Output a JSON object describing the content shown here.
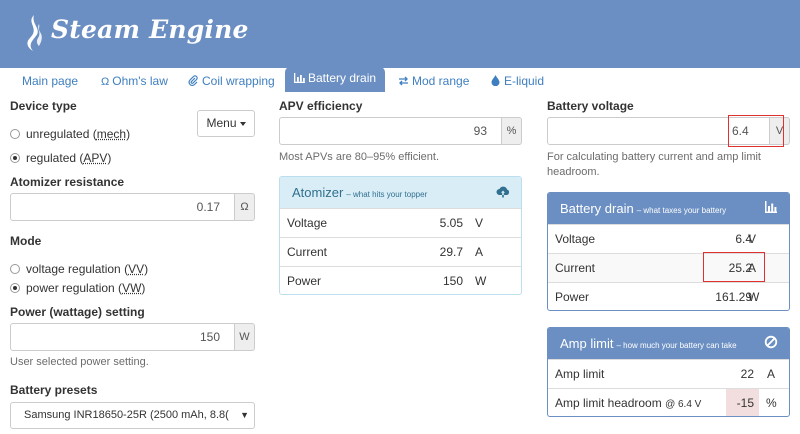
{
  "app": {
    "title": "Steam Engine"
  },
  "tabs": [
    {
      "label": "Main page",
      "icon": ""
    },
    {
      "label": "Ohm's law",
      "icon": "Ω"
    },
    {
      "label": "Coil wrapping",
      "icon": "paperclip-icon"
    },
    {
      "label": "Battery drain",
      "icon": "bar-chart-icon",
      "active": true
    },
    {
      "label": "Mod range",
      "icon": "swap-icon"
    },
    {
      "label": "E-liquid",
      "icon": "droplet-icon"
    }
  ],
  "left": {
    "device_type_label": "Device type",
    "menu_button": "Menu",
    "device_options": [
      {
        "pre": "unregulated (",
        "u": "mech",
        "post": ")",
        "checked": false
      },
      {
        "pre": "regulated (",
        "u": "APV",
        "post": ")",
        "checked": true
      }
    ],
    "atomizer_resistance_label": "Atomizer resistance",
    "atomizer_resistance_value": "0.17",
    "atomizer_resistance_unit": "Ω",
    "mode_label": "Mode",
    "mode_options": [
      {
        "pre": "voltage regulation (",
        "u": "VV",
        "post": ")",
        "checked": false
      },
      {
        "pre": "power regulation (",
        "u": "VW",
        "post": ")",
        "checked": true
      }
    ],
    "power_label": "Power (wattage) setting",
    "power_value": "150",
    "power_unit": "W",
    "power_help": "User selected power setting.",
    "presets_label": "Battery presets",
    "presets_selected": "Samsung INR18650-25R (2500 mAh, 8.8("
  },
  "middle": {
    "apv_label": "APV efficiency",
    "apv_value": "93",
    "apv_unit": "%",
    "apv_help": "Most APVs are 80–95% efficient.",
    "atomizer_panel": {
      "title": "Atomizer",
      "subtitle": "– what hits your topper",
      "rows": [
        {
          "label": "Voltage",
          "value": "5.05",
          "unit": "V"
        },
        {
          "label": "Current",
          "value": "29.7",
          "unit": "A"
        },
        {
          "label": "Power",
          "value": "150",
          "unit": "W"
        }
      ]
    }
  },
  "right": {
    "battery_voltage_label": "Battery voltage",
    "battery_voltage_value": "6.4",
    "battery_voltage_unit": "V",
    "battery_voltage_help": "For calculating battery current and amp limit headroom.",
    "drain_panel": {
      "title": "Battery drain",
      "subtitle": "– what taxes your battery",
      "rows": [
        {
          "label": "Voltage",
          "value": "6.4",
          "unit": "V"
        },
        {
          "label": "Current",
          "value": "25.2",
          "unit": "A"
        },
        {
          "label": "Power",
          "value": "161.29",
          "unit": "W"
        }
      ]
    },
    "amp_panel": {
      "title": "Amp limit",
      "subtitle": "– how much your battery can take",
      "rows": [
        {
          "label": "Amp limit",
          "sub": "",
          "value": "22",
          "unit": "A"
        },
        {
          "label": "Amp limit headroom",
          "sub": "@ 6.4 V",
          "value": "-15",
          "unit": "%"
        }
      ]
    }
  },
  "colors": {
    "header": "#6b8fc2",
    "link": "#3f7fbf",
    "warning_cell": "#f2dede",
    "highlight": "#e03030"
  }
}
